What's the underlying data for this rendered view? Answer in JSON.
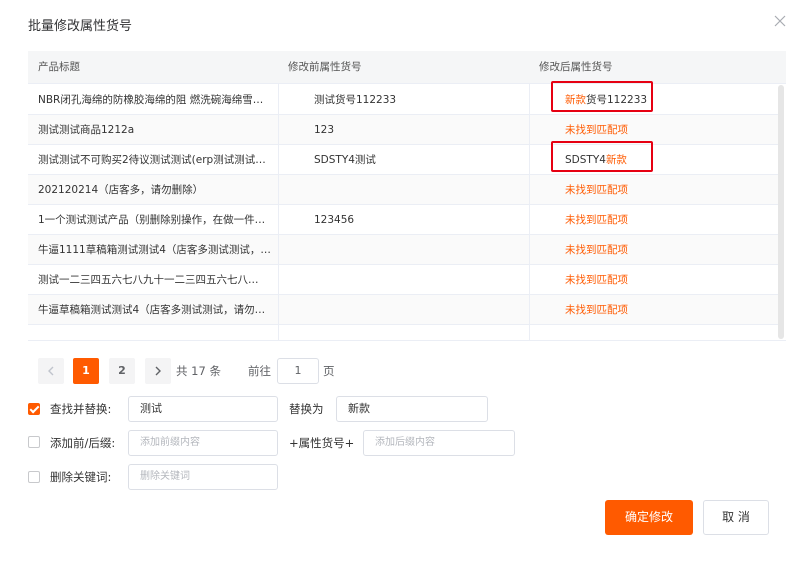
{
  "dialog": {
    "title": "批量修改属性货号",
    "close_icon": "close-icon"
  },
  "table": {
    "columns": [
      "产品标题",
      "修改前属性货号",
      "修改后属性货号"
    ],
    "rows": [
      {
        "title": "NBR闭孔海绵的防橡胶海绵的阻 燃洗碗海绵雪…",
        "before": "测试货号112233",
        "after_prefix": "新款",
        "after_rest": "货号112233",
        "matched": true,
        "highlighted": true
      },
      {
        "title": "测试测试商品1212a",
        "before": "123",
        "after_prefix": "",
        "after_rest": "未找到匹配项",
        "matched": false,
        "highlighted": false
      },
      {
        "title": "测试测试不可购买2待议测试测试(erp测试测试…",
        "before": "SDSTY4测试",
        "after_prefix": "SDSTY4",
        "after_rest": "新款",
        "matched": true,
        "highlighted": true
      },
      {
        "title": "202120214（店客多，请勿删除）",
        "before": "",
        "after_prefix": "",
        "after_rest": "未找到匹配项",
        "matched": false,
        "highlighted": false
      },
      {
        "title": "1一个测试测试产品（别删除别操作，在做一件…",
        "before": "123456",
        "after_prefix": "",
        "after_rest": "未找到匹配项",
        "matched": false,
        "highlighted": false
      },
      {
        "title": "牛逼1111草稿箱测试测试4（店客多测试测试，…",
        "before": "",
        "after_prefix": "",
        "after_rest": "未找到匹配项",
        "matched": false,
        "highlighted": false
      },
      {
        "title": "测试一二三四五六七八九十一二三四五六七八…",
        "before": "",
        "after_prefix": "",
        "after_rest": "未找到匹配项",
        "matched": false,
        "highlighted": false
      },
      {
        "title": "牛逼草稿箱测试测试4（店客多测试测试，请勿…",
        "before": "",
        "after_prefix": "",
        "after_rest": "未找到匹配项",
        "matched": false,
        "highlighted": false
      }
    ]
  },
  "pagination": {
    "pages": [
      "1",
      "2"
    ],
    "current": "1",
    "total_text": "共 17 条",
    "goto_prefix": "前往",
    "goto_value": "1",
    "goto_suffix": "页"
  },
  "options": {
    "find_replace": {
      "label": "查找并替换:",
      "checked": true,
      "find_value": "测试",
      "replace_label": "替换为",
      "replace_value": "新款"
    },
    "add_affix": {
      "label": "添加前/后缀:",
      "checked": false,
      "prefix_placeholder": "添加前缀内容",
      "middle_label": "+属性货号+",
      "suffix_placeholder": "添加后缀内容"
    },
    "delete_keyword": {
      "label": "删除关键词:",
      "checked": false,
      "placeholder": "删除关键词"
    }
  },
  "footer": {
    "confirm_label": "确定修改",
    "cancel_label": "取 消"
  },
  "colors": {
    "accent": "#ff5a00",
    "highlight_border": "#e60012"
  }
}
